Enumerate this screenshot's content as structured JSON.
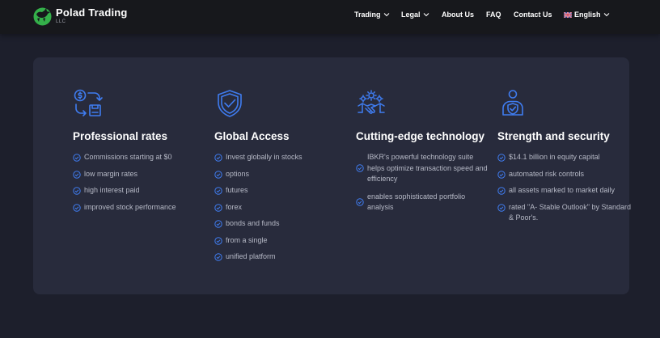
{
  "header": {
    "brand_name": "Polad Trading",
    "brand_sub": "LLC",
    "nav": [
      {
        "label": "Trading",
        "has_dropdown": true
      },
      {
        "label": "Legal",
        "has_dropdown": true
      },
      {
        "label": "About Us",
        "has_dropdown": false
      },
      {
        "label": "FAQ",
        "has_dropdown": false
      },
      {
        "label": "Contact Us",
        "has_dropdown": false
      },
      {
        "label": "English",
        "has_dropdown": true,
        "icon": "uk-flag-icon"
      }
    ]
  },
  "features": [
    {
      "icon": "currency-exchange-icon",
      "title": "Professional rates",
      "items": [
        "Commissions starting at $0",
        "low margin rates",
        "high interest paid",
        "improved stock performance"
      ]
    },
    {
      "icon": "shield-check-icon",
      "title": "Global Access",
      "items": [
        "Invest globally in stocks",
        "options",
        "futures",
        "forex",
        "bonds and funds",
        "from a single",
        "unified platform"
      ]
    },
    {
      "icon": "gears-handshake-icon",
      "title": "Cutting-edge technology",
      "items": [
        "IBKR's powerful technology suite helps optimize transaction speed and efficiency",
        "enables sophisticated portfolio analysis"
      ]
    },
    {
      "icon": "person-shield-icon",
      "title": "Strength and security",
      "items": [
        "$14.1 billion in equity capital",
        "automated risk controls",
        "all assets marked to market daily",
        "rated \"A- Stable Outlook\" by Standard & Poor's."
      ]
    }
  ],
  "colors": {
    "background": "#1d1f2c",
    "topbar": "#17181c",
    "card": "#282b3c",
    "accent_blue": "#3f7cf0",
    "brand_green": "#34b04a",
    "text_muted": "#b6b9c6"
  }
}
